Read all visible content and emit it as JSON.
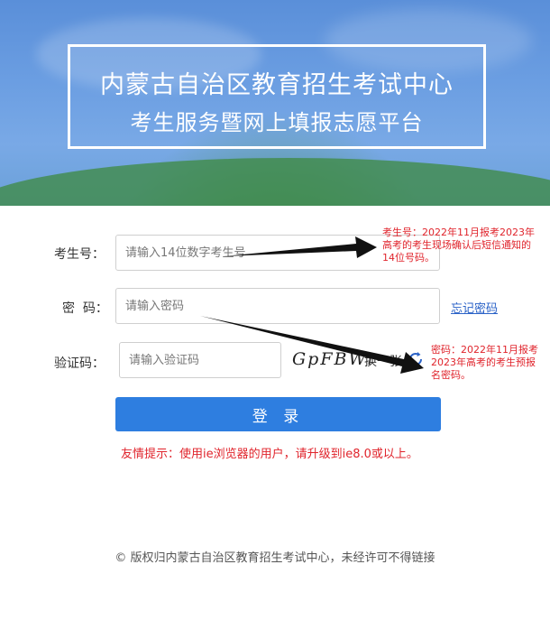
{
  "header": {
    "title_line1": "内蒙古自治区教育招生考试中心",
    "title_line2": "考生服务暨网上填报志愿平台"
  },
  "form": {
    "exam_no_label": "考生号：",
    "exam_no_placeholder": "请输入14位数字考生号",
    "password_label": "密  码：",
    "password_placeholder": "请输入密码",
    "forgot_password": "忘记密码",
    "captcha_label": "验证码：",
    "captcha_placeholder": "请输入验证码",
    "captcha_text": "GpFBWr",
    "refresh_text": "换一张",
    "login_button": "登 录"
  },
  "tip": "友情提示：使用ie浏览器的用户，请升级到ie8.0或以上。",
  "annotations": {
    "exam_no_note": [
      "考生号：2022年11月报考2023年",
      "高考的考生现场确认后短信通知的",
      "14位号码。"
    ],
    "password_note": [
      "密码：2022年11月报考",
      "2023年高考的考生预报",
      "名密码。"
    ]
  },
  "footer": "© 版权归内蒙古自治区教育招生考试中心，未经许可不得链接",
  "colors": {
    "primary_button": "#2e7ee0",
    "annotation_red": "#e0242c",
    "link_blue": "#2a62c7"
  }
}
